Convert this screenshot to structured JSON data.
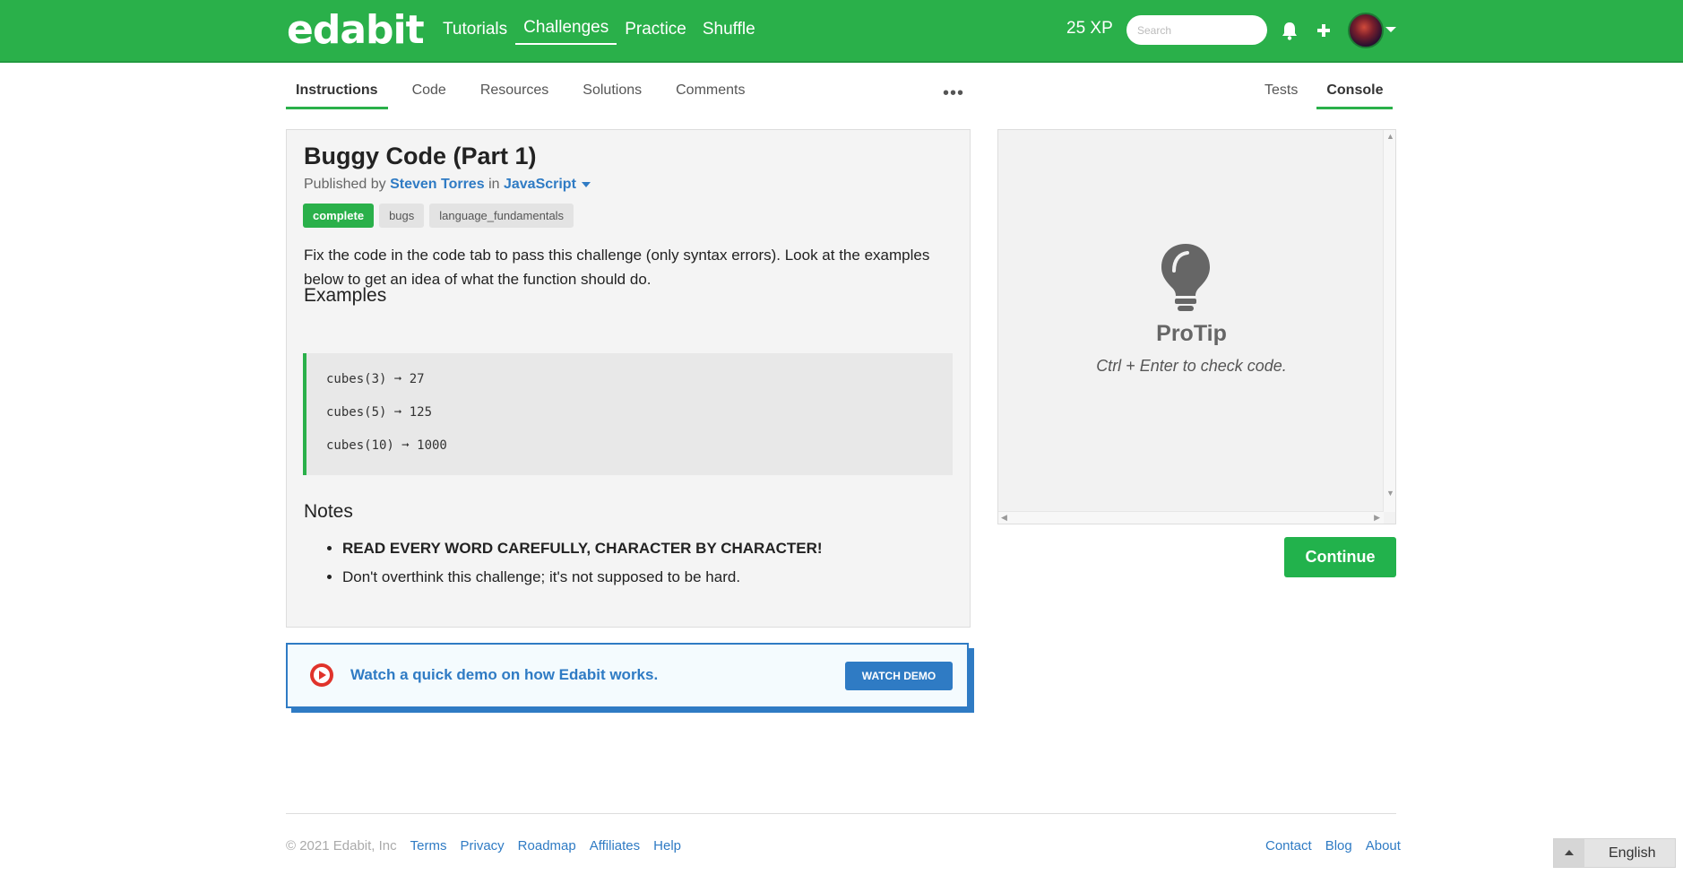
{
  "header": {
    "logo": "edabit",
    "nav": [
      "Tutorials",
      "Challenges",
      "Practice",
      "Shuffle"
    ],
    "active_nav": "Challenges",
    "xp": "25 XP",
    "search_placeholder": "Search",
    "brand_color": "#2ab04a"
  },
  "tabs": {
    "left": [
      "Instructions",
      "Code",
      "Resources",
      "Solutions",
      "Comments"
    ],
    "active_left": "Instructions",
    "more": "•••",
    "right": [
      "Tests",
      "Console"
    ],
    "active_right": "Console"
  },
  "challenge": {
    "title": "Buggy Code (Part 1)",
    "published_by_prefix": "Published by",
    "author": "Steven Torres",
    "in_word": "in",
    "language": "JavaScript",
    "tags": [
      "complete",
      "bugs",
      "language_fundamentals"
    ],
    "description": "Fix the code in the code tab to pass this challenge (only syntax errors). Look at the examples below to get an idea of what the function should do.",
    "examples_heading": "Examples",
    "examples": [
      "cubes(3) ➞ 27",
      "cubes(5) ➞ 125",
      "cubes(10) ➞ 1000"
    ],
    "notes_heading": "Notes",
    "notes": [
      "READ EVERY WORD CAREFULLY, CHARACTER BY CHARACTER!",
      "Don't overthink this challenge; it's not supposed to be hard."
    ]
  },
  "demo": {
    "text": "Watch a quick demo on how Edabit works.",
    "button": "WATCH DEMO"
  },
  "console": {
    "protip_title": "ProTip",
    "protip_text": "Ctrl + Enter to check code.",
    "continue_label": "Continue"
  },
  "footer": {
    "copyright": "© 2021 Edabit, Inc",
    "left_links": [
      "Terms",
      "Privacy",
      "Roadmap",
      "Affiliates",
      "Help"
    ],
    "right_links": [
      "Contact",
      "Blog",
      "About"
    ],
    "language": "English"
  }
}
